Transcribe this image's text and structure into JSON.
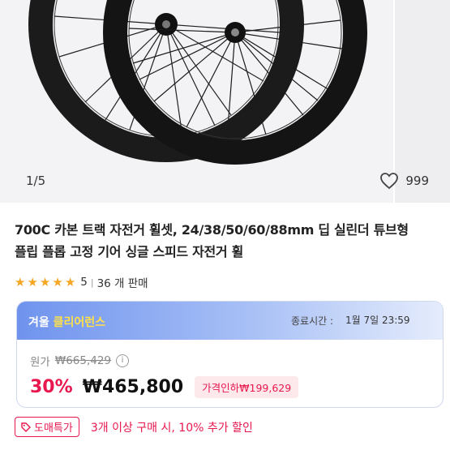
{
  "gallery": {
    "counter": "1/5",
    "wish_count": "999"
  },
  "product": {
    "title_line1": "700C 카본 트랙 자전거 휠셋, 24/38/50/60/88mm 딥 실린더 튜브형",
    "title_line2": "플립 플롭 고정 기어 싱글 스피드 자전거 휠",
    "rating": "5",
    "sold": "36 개 판매"
  },
  "promo": {
    "name_part1": "겨울",
    "name_part2": "클리어런스",
    "timer_label": "종료시간 :",
    "timer_value": "1월 7일 23:59",
    "orig_label": "원가",
    "orig_price": "₩665,429",
    "discount": "30%",
    "price": "₩465,800",
    "badge": "가격인하₩199,629"
  },
  "wholesale": {
    "badge": "도매특가",
    "text": "3개 이상 구매 시, 10% 추가 할인"
  },
  "colors": {
    "accent": "#e8174d",
    "star": "#f5a623",
    "promo_blue": "#6f93ee"
  }
}
